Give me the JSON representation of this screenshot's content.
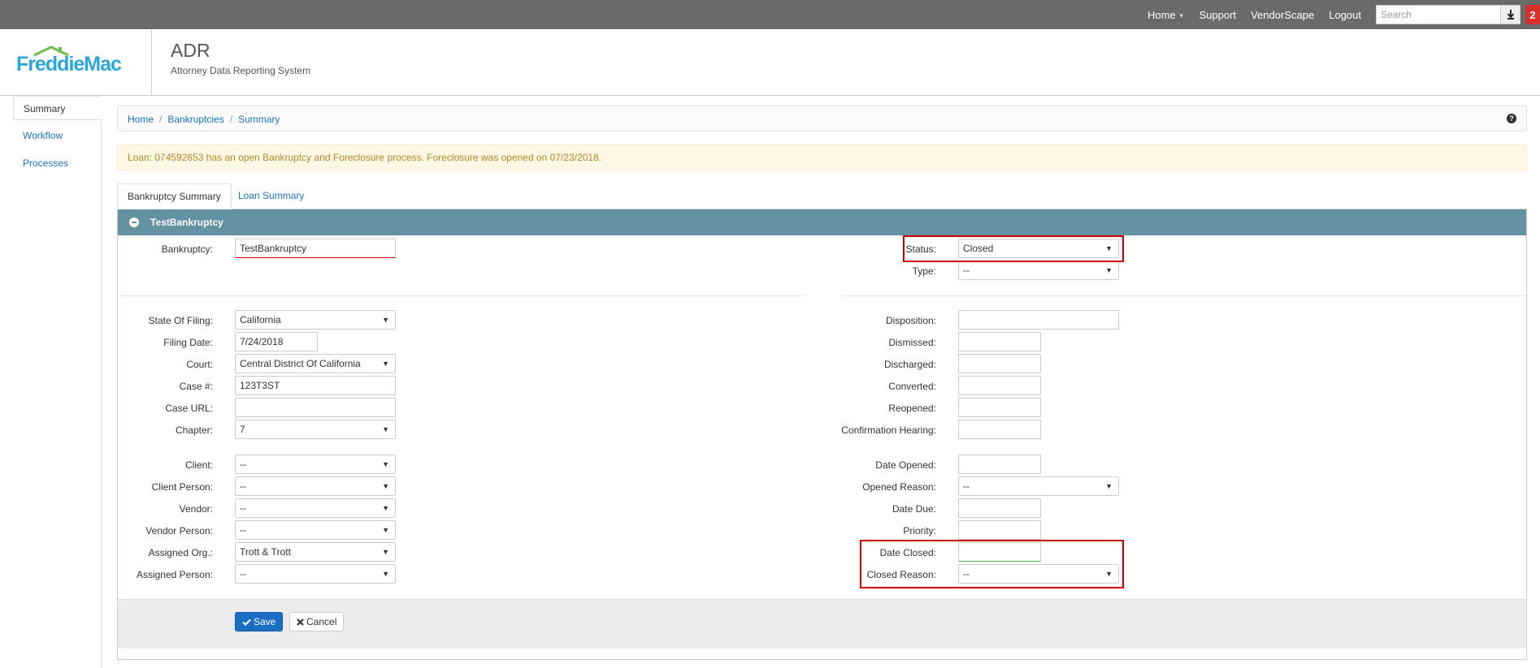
{
  "topnav": {
    "home": "Home",
    "support": "Support",
    "vendorscape": "VendorScape",
    "logout": "Logout",
    "search_placeholder": "Search",
    "notifications": "2"
  },
  "header": {
    "logo_text": "FreddieMac",
    "app_title": "ADR",
    "app_subtitle": "Attorney Data Reporting System"
  },
  "sidebar": {
    "items": [
      {
        "label": "Summary"
      },
      {
        "label": "Workflow"
      },
      {
        "label": "Processes"
      }
    ]
  },
  "breadcrumb": {
    "items": [
      "Home",
      "Bankruptcies",
      "Summary"
    ],
    "help_icon": "question-circle-icon"
  },
  "alert": {
    "text": "Loan: 074592653 has an open Bankruptcy and Foreclosure process. Foreclosure was opened on 07/23/2018."
  },
  "tabs": [
    {
      "label": "Bankruptcy Summary"
    },
    {
      "label": "Loan Summary"
    }
  ],
  "panel": {
    "title": "TestBankruptcy"
  },
  "form": {
    "left": {
      "bankruptcy": {
        "label": "Bankruptcy:",
        "value": "TestBankruptcy"
      },
      "state_of_filing": {
        "label": "State Of Filing:",
        "value": "California"
      },
      "filing_date": {
        "label": "Filing Date:",
        "value": "7/24/2018"
      },
      "court": {
        "label": "Court:",
        "value": "Central District Of California"
      },
      "case_number": {
        "label": "Case #:",
        "value": "123T3ST"
      },
      "case_url": {
        "label": "Case URL:",
        "value": ""
      },
      "chapter": {
        "label": "Chapter:",
        "value": "7"
      },
      "client": {
        "label": "Client:",
        "value": "--"
      },
      "client_person": {
        "label": "Client Person:",
        "value": "--"
      },
      "vendor": {
        "label": "Vendor:",
        "value": "--"
      },
      "vendor_person": {
        "label": "Vendor Person:",
        "value": "--"
      },
      "assigned_org": {
        "label": "Assigned Org.:",
        "value": "Trott & Trott"
      },
      "assigned_person": {
        "label": "Assigned Person:",
        "value": "--"
      }
    },
    "right": {
      "status": {
        "label": "Status:",
        "value": "Closed"
      },
      "type": {
        "label": "Type:",
        "value": "--"
      },
      "disposition": {
        "label": "Disposition:",
        "value": ""
      },
      "dismissed": {
        "label": "Dismissed:",
        "value": ""
      },
      "discharged": {
        "label": "Discharged:",
        "value": ""
      },
      "converted": {
        "label": "Converted:",
        "value": ""
      },
      "reopened": {
        "label": "Reopened:",
        "value": ""
      },
      "confirmation_hearing": {
        "label": "Confirmation Hearing:",
        "value": ""
      },
      "date_opened": {
        "label": "Date Opened:",
        "value": ""
      },
      "opened_reason": {
        "label": "Opened Reason:",
        "value": "--"
      },
      "date_due": {
        "label": "Date Due:",
        "value": ""
      },
      "priority": {
        "label": "Priority:",
        "value": ""
      },
      "date_closed": {
        "label": "Date Closed:",
        "value": ""
      },
      "closed_reason": {
        "label": "Closed Reason:",
        "value": "--"
      }
    }
  },
  "buttons": {
    "save": "Save",
    "cancel": "Cancel"
  },
  "colors": {
    "panel_header": "#6492a3",
    "highlight": "#cc0000",
    "link": "#1a73c8",
    "primary_button": "#1a6fc4"
  }
}
